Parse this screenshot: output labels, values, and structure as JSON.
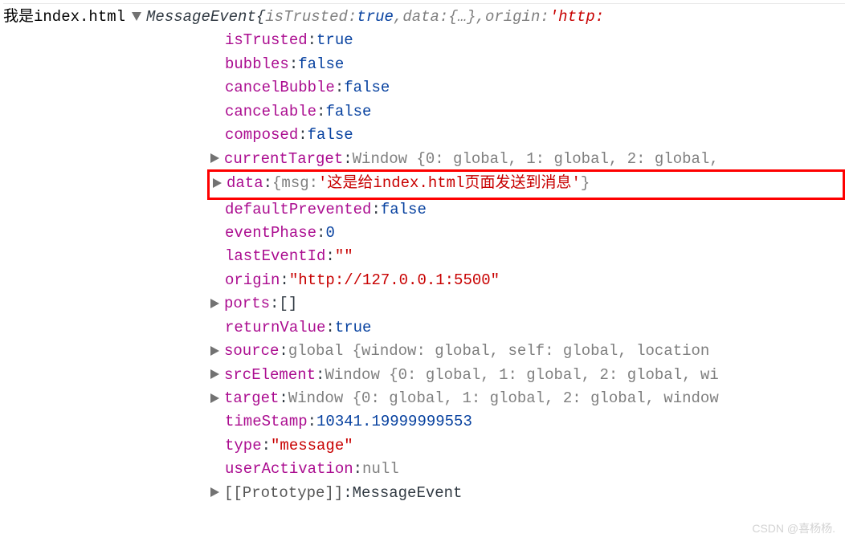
{
  "leftLabel": "我是index.html",
  "summary": {
    "className": "MessageEvent",
    "braceOpen": " {",
    "items": [
      {
        "key": "isTrusted",
        "val": "true",
        "valClass": "bool-true"
      },
      {
        "key": "data",
        "val": "{…}",
        "valClass": "summary-gray"
      },
      {
        "key": "origin",
        "val": "'http:",
        "valClass": "string",
        "truncated": true
      }
    ]
  },
  "props": {
    "isTrusted": {
      "key": "isTrusted",
      "val": "true",
      "valClass": "bool-true"
    },
    "bubbles": {
      "key": "bubbles",
      "val": "false",
      "valClass": "bool-false"
    },
    "cancelBubble": {
      "key": "cancelBubble",
      "val": "false",
      "valClass": "bool-false"
    },
    "cancelable": {
      "key": "cancelable",
      "val": "false",
      "valClass": "bool-false"
    },
    "composed": {
      "key": "composed",
      "val": "false",
      "valClass": "bool-false"
    },
    "currentTarget": {
      "key": "currentTarget",
      "val": "Window {0: global, 1: global, 2: global,",
      "valClass": "obj-gray",
      "expandable": true
    },
    "data": {
      "key": "data",
      "valPrefix": "{msg: ",
      "valString": "'这是给index.html页面发送到消息'",
      "valSuffix": "}",
      "expandable": true,
      "highlighted": true
    },
    "defaultPrevented": {
      "key": "defaultPrevented",
      "val": "false",
      "valClass": "bool-false"
    },
    "eventPhase": {
      "key": "eventPhase",
      "val": "0",
      "valClass": "number"
    },
    "lastEventId": {
      "key": "lastEventId",
      "val": "\"\"",
      "valClass": "string"
    },
    "origin": {
      "key": "origin",
      "val": "\"http://127.0.0.1:5500\"",
      "valClass": "string"
    },
    "ports": {
      "key": "ports",
      "val": "[]",
      "valClass": "obj-preview",
      "expandable": true
    },
    "returnValue": {
      "key": "returnValue",
      "val": "true",
      "valClass": "bool-true"
    },
    "source": {
      "key": "source",
      "val": "global {window: global, self: global, location",
      "valClass": "obj-gray",
      "expandable": true
    },
    "srcElement": {
      "key": "srcElement",
      "val": "Window {0: global, 1: global, 2: global, wi",
      "valClass": "obj-gray",
      "expandable": true
    },
    "target": {
      "key": "target",
      "val": "Window {0: global, 1: global, 2: global, window",
      "valClass": "obj-gray",
      "expandable": true
    },
    "timeStamp": {
      "key": "timeStamp",
      "val": "10341.19999999553",
      "valClass": "number"
    },
    "type": {
      "key": "type",
      "val": "\"message\"",
      "valClass": "string"
    },
    "userActivation": {
      "key": "userActivation",
      "val": "null",
      "valClass": "null"
    },
    "prototype": {
      "key": "[[Prototype]]",
      "val": "MessageEvent",
      "valClass": "obj-preview",
      "expandable": true,
      "dark": true
    }
  },
  "watermark": "CSDN @喜杨杨."
}
